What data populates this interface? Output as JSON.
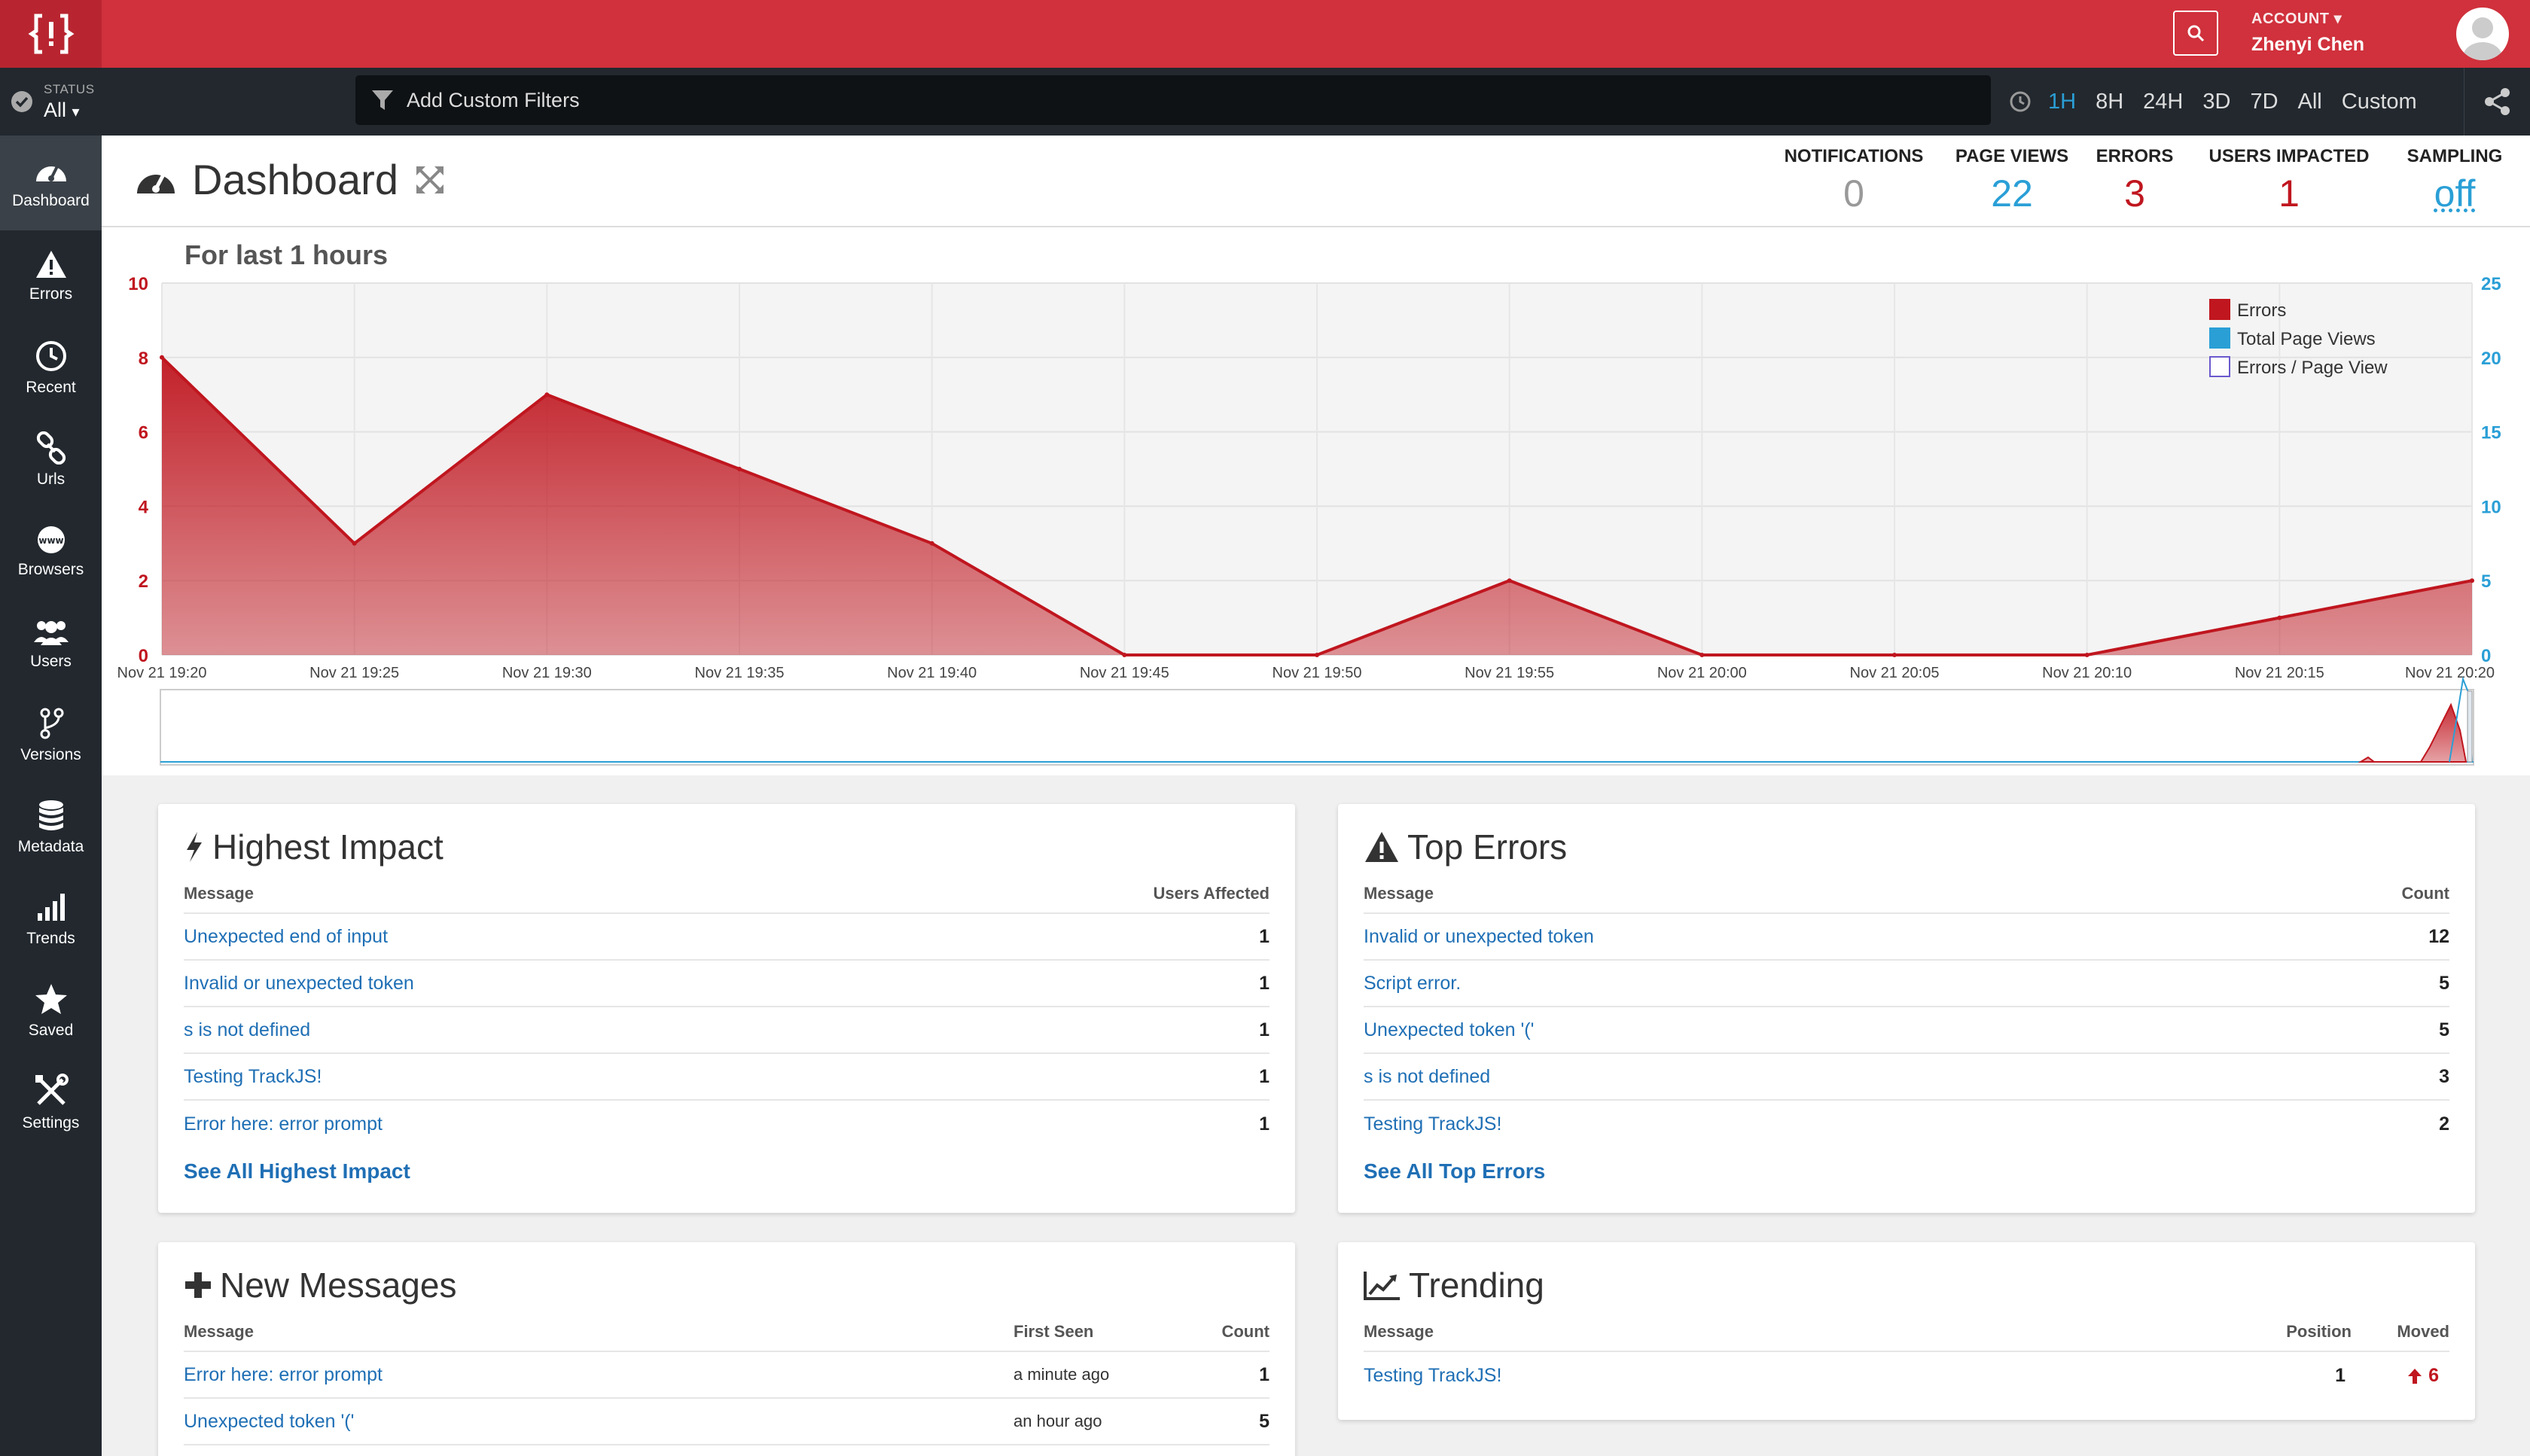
{
  "account": {
    "label": "ACCOUNT",
    "name": "Zhenyi Chen"
  },
  "filterbar": {
    "status_label": "STATUS",
    "status_value": "All",
    "filter_placeholder": "Add Custom Filters",
    "time_options": [
      "1H",
      "8H",
      "24H",
      "3D",
      "7D",
      "All",
      "Custom"
    ],
    "time_selected": "1H"
  },
  "sidebar": {
    "items": [
      {
        "label": "Dashboard",
        "icon": "dashboard-icon"
      },
      {
        "label": "Errors",
        "icon": "warning-icon"
      },
      {
        "label": "Recent",
        "icon": "clock-icon"
      },
      {
        "label": "Urls",
        "icon": "link-icon"
      },
      {
        "label": "Browsers",
        "icon": "www-icon"
      },
      {
        "label": "Users",
        "icon": "users-icon"
      },
      {
        "label": "Versions",
        "icon": "branch-icon"
      },
      {
        "label": "Metadata",
        "icon": "database-icon"
      },
      {
        "label": "Trends",
        "icon": "bar-chart-icon"
      },
      {
        "label": "Saved",
        "icon": "star-icon"
      },
      {
        "label": "Settings",
        "icon": "tools-icon"
      }
    ]
  },
  "header": {
    "title": "Dashboard",
    "stats": [
      {
        "label": "NOTIFICATIONS",
        "value": "0",
        "color": "#999999"
      },
      {
        "label": "PAGE VIEWS",
        "value": "22",
        "color": "#2a9fd6"
      },
      {
        "label": "ERRORS",
        "value": "3",
        "color": "#c0161f"
      },
      {
        "label": "USERS IMPACTED",
        "value": "1",
        "color": "#c0161f"
      },
      {
        "label": "SAMPLING",
        "value": "off",
        "color": "#2a9fd6"
      }
    ]
  },
  "chart": {
    "title": "For last 1 hours"
  },
  "chart_data": {
    "type": "area",
    "title": "For last 1 hours",
    "x": [
      "Nov 21 19:20",
      "Nov 21 19:25",
      "Nov 21 19:30",
      "Nov 21 19:35",
      "Nov 21 19:40",
      "Nov 21 19:45",
      "Nov 21 19:50",
      "Nov 21 19:55",
      "Nov 21 20:00",
      "Nov 21 20:05",
      "Nov 21 20:10",
      "Nov 21 20:15",
      "Nov 21 20:20"
    ],
    "series": [
      {
        "name": "Errors",
        "axis": "left",
        "color": "#c0161f",
        "values": [
          8,
          3,
          7,
          5,
          3,
          0,
          0,
          2,
          0,
          0,
          0,
          1,
          2
        ]
      },
      {
        "name": "Total Page Views",
        "axis": "right",
        "color": "#2a9fd6",
        "values": []
      },
      {
        "name": "Errors / Page View",
        "axis": "right",
        "color": "#ffffff",
        "values": []
      }
    ],
    "ylim_left": [
      0,
      10
    ],
    "yticks_left": [
      0,
      2,
      4,
      6,
      8,
      10
    ],
    "ylim_right": [
      0,
      25
    ],
    "yticks_right": [
      0,
      5,
      10,
      15,
      20,
      25
    ],
    "grid": true,
    "legend": "top-right"
  },
  "highest_impact": {
    "title": "Highest Impact",
    "col_message": "Message",
    "col_count": "Users Affected",
    "rows": [
      {
        "message": "Unexpected end of input",
        "count": "1"
      },
      {
        "message": "Invalid or unexpected token",
        "count": "1"
      },
      {
        "message": "s is not defined",
        "count": "1"
      },
      {
        "message": "Testing TrackJS!",
        "count": "1"
      },
      {
        "message": "Error here: error prompt",
        "count": "1"
      }
    ],
    "see_all": "See All Highest Impact"
  },
  "top_errors": {
    "title": "Top Errors",
    "col_message": "Message",
    "col_count": "Count",
    "rows": [
      {
        "message": "Invalid or unexpected token",
        "count": "12"
      },
      {
        "message": "Script error.",
        "count": "5"
      },
      {
        "message": "Unexpected token '('",
        "count": "5"
      },
      {
        "message": "s is not defined",
        "count": "3"
      },
      {
        "message": "Testing TrackJS!",
        "count": "2"
      }
    ],
    "see_all": "See All Top Errors"
  },
  "new_messages": {
    "title": "New Messages",
    "col_message": "Message",
    "col_first_seen": "First Seen",
    "col_count": "Count",
    "rows": [
      {
        "message": "Error here: error prompt",
        "first_seen": "a minute ago",
        "count": "1"
      },
      {
        "message": "Unexpected token '('",
        "first_seen": "an hour ago",
        "count": "5"
      }
    ]
  },
  "trending": {
    "title": "Trending",
    "col_message": "Message",
    "col_position": "Position",
    "col_moved": "Moved",
    "rows": [
      {
        "message": "Testing TrackJS!",
        "position": "1",
        "moved": "6"
      }
    ]
  }
}
